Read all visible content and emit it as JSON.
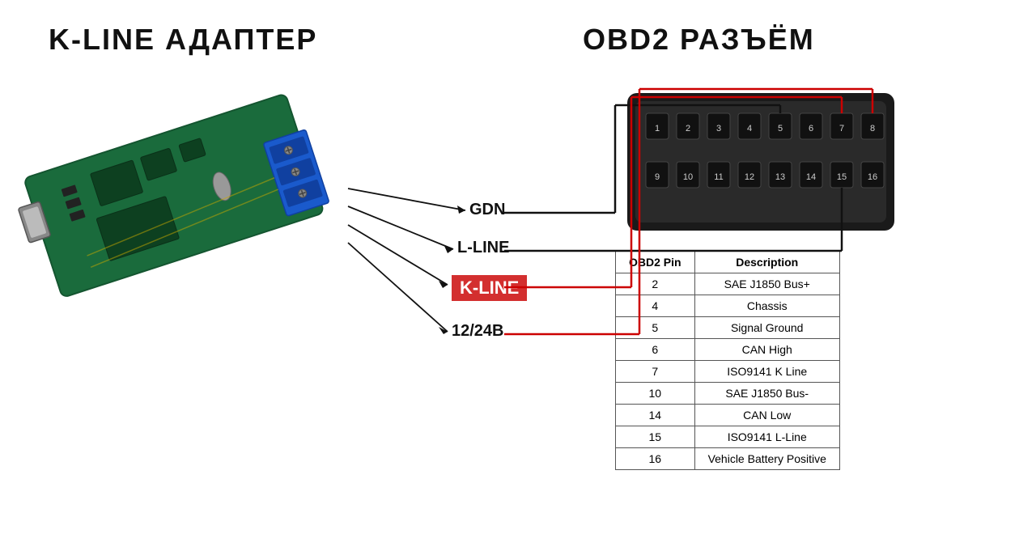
{
  "title_left": "K-LINE АДАПТЕР",
  "title_right": "OBD2 РАЗЪЁМ",
  "labels": {
    "gdn": "GDN",
    "lline": "L-LINE",
    "kline": "K-LINE",
    "power": "12/24В"
  },
  "obd_pins": [
    1,
    2,
    3,
    4,
    5,
    6,
    7,
    8,
    9,
    10,
    11,
    12,
    13,
    14,
    15,
    16
  ],
  "table": {
    "headers": [
      "OBD2 Pin",
      "Description"
    ],
    "rows": [
      [
        "2",
        "SAE J1850 Bus+"
      ],
      [
        "4",
        "Chassis"
      ],
      [
        "5",
        "Signal Ground"
      ],
      [
        "6",
        "CAN High"
      ],
      [
        "7",
        "ISO9141 K Line"
      ],
      [
        "10",
        "SAE J1850 Bus-"
      ],
      [
        "14",
        "CAN Low"
      ],
      [
        "15",
        "ISO9141 L-Line"
      ],
      [
        "16",
        "Vehicle Battery Positive"
      ]
    ]
  }
}
